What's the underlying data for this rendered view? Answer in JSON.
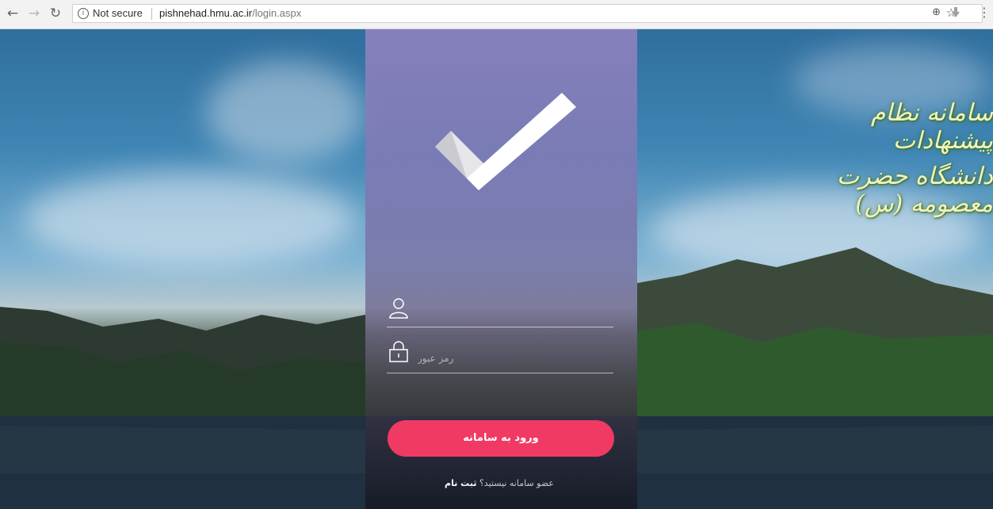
{
  "browser": {
    "security_label": "Not secure",
    "url_host": "pishnehad.hmu.ac.ir",
    "url_path": "/login.aspx"
  },
  "hero": {
    "title_line_1": "سامانه نظام پیشنهادات",
    "title_line_2": "دانشگاه حضرت معصومه (س)"
  },
  "login": {
    "username_placeholder": "",
    "password_placeholder": "رمز عبور",
    "submit_label": "ورود به سامانه",
    "register_prompt": "عضو سامانه نیستید؟",
    "register_link": "ثبت نام"
  },
  "colors": {
    "accent": "#f03a63",
    "panel": "#8c82be",
    "title_text": "#f4f2b8"
  },
  "icons": [
    "back-icon",
    "forward-icon",
    "reload-icon",
    "info-icon",
    "zoom-icon",
    "star-icon",
    "extension-icon",
    "menu-icon",
    "checkmark-logo-icon",
    "user-icon",
    "lock-icon"
  ]
}
